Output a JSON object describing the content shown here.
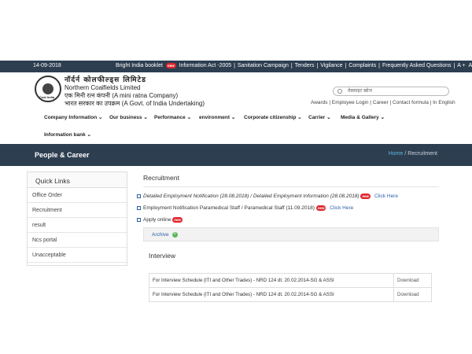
{
  "topbar": {
    "date": "14-09-2018",
    "links": [
      "Bright India booklet",
      "Information Act -2005",
      "Sanitation Campaign",
      "Tenders",
      "Vigilance",
      "Complaints",
      "Frequently Asked Questions",
      "A +",
      "A-"
    ],
    "new_label": "new"
  },
  "header": {
    "org_hindi": "नॉर्दर्न कोलफील्ड्स लिमिटेड",
    "org_english": "Northern Coalfields Limited",
    "mini_ratna": "एक मिनी रत्न कंपनी (A mini ratna Company)",
    "govt": "भारत सरकार का उपक्रम (A Govt. of India Undertaking)",
    "logo_text": "Coal India",
    "search_placeholder": "वेबसाइट खोज",
    "utility_links": "Awards | Employee Login | Career | Contact formula | In English"
  },
  "nav": {
    "items": [
      "Company Information",
      "Our business",
      "Performance",
      "environment",
      "Corporate citizenship",
      "Carrier",
      "Media & Gallery",
      "Information bank"
    ],
    "arrow": "⌄"
  },
  "banner": {
    "title": "People & Career",
    "crumb_home": "Home",
    "crumb_sep": "/",
    "crumb_current": "Recruitment"
  },
  "quick_links": {
    "title": "Quick Links",
    "items": [
      "Office Order",
      "Recruitment",
      "result",
      "Ncs portal",
      "Unacceptable"
    ]
  },
  "recruitment": {
    "title": "Recruitment",
    "items": [
      {
        "text": "Detailed Employment Notification (28.08.2018) / Detailed Employment Information (28.08.2018)",
        "link": "Click Here"
      },
      {
        "text": "Employment Notification Paramedical Staff / Paramedical Staff (11.09.2018)",
        "link": "Click Here"
      },
      {
        "text": "Apply online",
        "link": ""
      }
    ],
    "archive": "Archive"
  },
  "interview": {
    "title": "Interview",
    "rows": [
      {
        "text": "For Interview Schedule (ITI and Other Trades) - NRD 124 dt. 20.02.2014-SG & ASSI",
        "action": "Download"
      },
      {
        "text": "For Interview Schedule (ITI and Other Trades) - NRD 124 dt. 20.02.2014-SG & ASSI",
        "action": "Download"
      }
    ]
  }
}
